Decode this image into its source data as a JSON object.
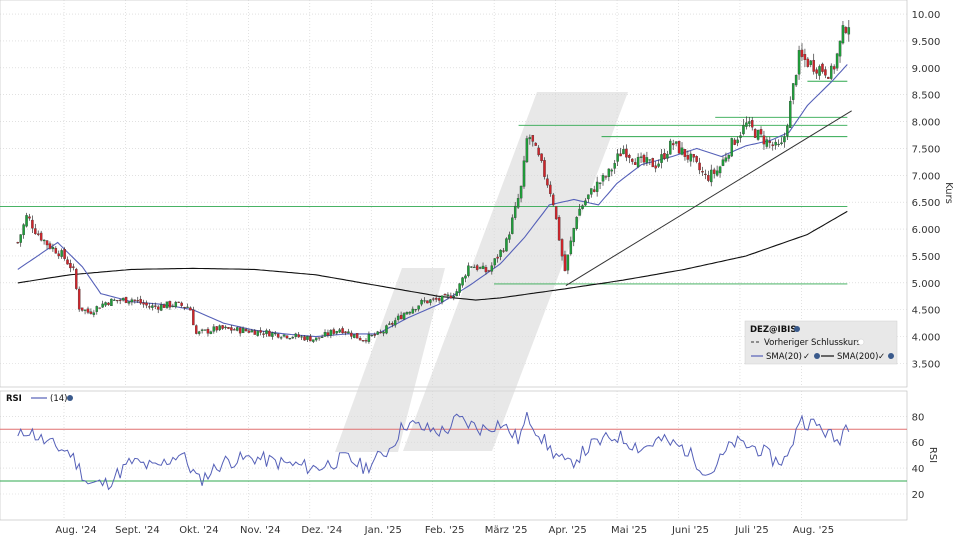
{
  "chart_data": {
    "type": "candlestick",
    "symbol": "DEZ@IBIS",
    "x_labels": [
      "Aug. '24",
      "Sept. '24",
      "Okt. '24",
      "Nov. '24",
      "Dez. '24",
      "Jan. '25",
      "Feb. '25",
      "März '25",
      "Apr. '25",
      "Mai '25",
      "Juni '25",
      "Juli '25",
      "Aug. '25"
    ],
    "price_axis": {
      "label": "Kurs",
      "ticks": [
        "10.00",
        "9.500",
        "9.000",
        "8.500",
        "8.000",
        "7.500",
        "7.000",
        "6.500",
        "6.000",
        "5.500",
        "5.000",
        "4.500",
        "4.000",
        "3.500"
      ],
      "ylim": [
        3.1,
        10.15
      ]
    },
    "rsi_axis": {
      "label": "RSI",
      "ticks": [
        "80",
        "60",
        "40",
        "20"
      ],
      "ylim": [
        0,
        100
      ],
      "overbought": 70,
      "oversold": 30
    },
    "legend": {
      "title": "DEZ@IBIS",
      "prev_close": "Vorheriger Schlusskurs",
      "sma20": "SMA(20)",
      "sma200": "SMA(200)"
    },
    "rsi_legend": {
      "title": "RSI",
      "period": "(14)"
    },
    "horizontal_levels": [
      {
        "y": 6.42,
        "from": 0.0,
        "to": 12.65
      },
      {
        "y": 4.98,
        "from": 6.9,
        "to": 12.65
      },
      {
        "y": 7.93,
        "from": 7.3,
        "to": 12.65
      },
      {
        "y": 7.72,
        "from": 8.65,
        "to": 12.65
      },
      {
        "y": 8.08,
        "from": 10.5,
        "to": 12.65
      },
      {
        "y": 8.75,
        "from": 12.0,
        "to": 12.65
      }
    ],
    "trendline": {
      "x1": 8.07,
      "y1": 4.95,
      "x2": 12.72,
      "y2": 8.2
    },
    "ohlc_anchors": [
      {
        "m": -0.85,
        "c": 5.75
      },
      {
        "m": -0.7,
        "c": 6.25
      },
      {
        "m": -0.55,
        "c": 5.95
      },
      {
        "m": -0.35,
        "c": 5.7
      },
      {
        "m": -0.15,
        "c": 5.55
      },
      {
        "m": 0.05,
        "c": 5.25
      },
      {
        "m": 0.15,
        "c": 4.55
      },
      {
        "m": 0.3,
        "c": 4.45
      },
      {
        "m": 0.6,
        "c": 4.65
      },
      {
        "m": 1.0,
        "c": 4.7
      },
      {
        "m": 1.3,
        "c": 4.55
      },
      {
        "m": 1.7,
        "c": 4.6
      },
      {
        "m": 1.95,
        "c": 4.55
      },
      {
        "m": 2.05,
        "c": 4.05
      },
      {
        "m": 2.4,
        "c": 4.15
      },
      {
        "m": 3.0,
        "c": 4.1
      },
      {
        "m": 3.35,
        "c": 4.05
      },
      {
        "m": 3.7,
        "c": 4.0
      },
      {
        "m": 4.0,
        "c": 3.95
      },
      {
        "m": 4.4,
        "c": 4.15
      },
      {
        "m": 4.75,
        "c": 3.95
      },
      {
        "m": 5.05,
        "c": 4.05
      },
      {
        "m": 5.45,
        "c": 4.45
      },
      {
        "m": 5.75,
        "c": 4.65
      },
      {
        "m": 6.1,
        "c": 4.7
      },
      {
        "m": 6.3,
        "c": 4.85
      },
      {
        "m": 6.5,
        "c": 5.35
      },
      {
        "m": 6.8,
        "c": 5.2
      },
      {
        "m": 7.1,
        "c": 5.75
      },
      {
        "m": 7.35,
        "c": 6.8
      },
      {
        "m": 7.45,
        "c": 7.8
      },
      {
        "m": 7.65,
        "c": 7.25
      },
      {
        "m": 7.85,
        "c": 6.6
      },
      {
        "m": 7.95,
        "c": 5.9
      },
      {
        "m": 8.05,
        "c": 5.2
      },
      {
        "m": 8.25,
        "c": 6.3
      },
      {
        "m": 8.55,
        "c": 6.8
      },
      {
        "m": 8.75,
        "c": 7.0
      },
      {
        "m": 9.0,
        "c": 7.5
      },
      {
        "m": 9.25,
        "c": 7.25
      },
      {
        "m": 9.55,
        "c": 7.2
      },
      {
        "m": 9.8,
        "c": 7.6
      },
      {
        "m": 10.1,
        "c": 7.3
      },
      {
        "m": 10.35,
        "c": 6.95
      },
      {
        "m": 10.55,
        "c": 7.1
      },
      {
        "m": 10.75,
        "c": 7.55
      },
      {
        "m": 11.0,
        "c": 7.95
      },
      {
        "m": 11.25,
        "c": 7.7
      },
      {
        "m": 11.5,
        "c": 7.5
      },
      {
        "m": 11.6,
        "c": 7.55
      },
      {
        "m": 11.75,
        "c": 8.5
      },
      {
        "m": 11.85,
        "c": 9.2
      },
      {
        "m": 12.1,
        "c": 9.05
      },
      {
        "m": 12.4,
        "c": 8.9
      },
      {
        "m": 12.5,
        "c": 9.3
      },
      {
        "m": 12.6,
        "c": 9.75
      },
      {
        "m": 12.68,
        "c": 9.85
      }
    ],
    "sma20_anchors": [
      {
        "m": -0.85,
        "v": 5.25
      },
      {
        "m": -0.4,
        "v": 5.6
      },
      {
        "m": -0.2,
        "v": 5.75
      },
      {
        "m": 0.2,
        "v": 5.3
      },
      {
        "m": 0.5,
        "v": 4.8
      },
      {
        "m": 1.0,
        "v": 4.65
      },
      {
        "m": 1.5,
        "v": 4.6
      },
      {
        "m": 2.0,
        "v": 4.5
      },
      {
        "m": 2.5,
        "v": 4.25
      },
      {
        "m": 3.0,
        "v": 4.12
      },
      {
        "m": 3.5,
        "v": 4.05
      },
      {
        "m": 4.0,
        "v": 4.0
      },
      {
        "m": 4.5,
        "v": 4.05
      },
      {
        "m": 5.0,
        "v": 4.05
      },
      {
        "m": 5.5,
        "v": 4.35
      },
      {
        "m": 6.0,
        "v": 4.6
      },
      {
        "m": 6.5,
        "v": 4.95
      },
      {
        "m": 7.0,
        "v": 5.35
      },
      {
        "m": 7.4,
        "v": 5.85
      },
      {
        "m": 7.8,
        "v": 6.45
      },
      {
        "m": 8.2,
        "v": 6.55
      },
      {
        "m": 8.6,
        "v": 6.45
      },
      {
        "m": 8.9,
        "v": 6.85
      },
      {
        "m": 9.3,
        "v": 7.2
      },
      {
        "m": 9.8,
        "v": 7.35
      },
      {
        "m": 10.2,
        "v": 7.5
      },
      {
        "m": 10.6,
        "v": 7.35
      },
      {
        "m": 11.0,
        "v": 7.55
      },
      {
        "m": 11.4,
        "v": 7.65
      },
      {
        "m": 11.7,
        "v": 7.8
      },
      {
        "m": 12.0,
        "v": 8.3
      },
      {
        "m": 12.4,
        "v": 8.75
      },
      {
        "m": 12.68,
        "v": 9.1
      }
    ],
    "sma200_anchors": [
      {
        "m": -0.85,
        "v": 5.0
      },
      {
        "m": 0.0,
        "v": 5.15
      },
      {
        "m": 1.0,
        "v": 5.25
      },
      {
        "m": 2.0,
        "v": 5.27
      },
      {
        "m": 3.0,
        "v": 5.25
      },
      {
        "m": 4.0,
        "v": 5.15
      },
      {
        "m": 5.0,
        "v": 4.95
      },
      {
        "m": 6.0,
        "v": 4.75
      },
      {
        "m": 6.6,
        "v": 4.68
      },
      {
        "m": 7.0,
        "v": 4.72
      },
      {
        "m": 8.0,
        "v": 4.88
      },
      {
        "m": 9.0,
        "v": 5.05
      },
      {
        "m": 10.0,
        "v": 5.25
      },
      {
        "m": 11.0,
        "v": 5.5
      },
      {
        "m": 12.0,
        "v": 5.9
      },
      {
        "m": 12.68,
        "v": 6.35
      }
    ],
    "rsi_anchors": [
      {
        "m": -0.85,
        "v": 63
      },
      {
        "m": -0.7,
        "v": 70
      },
      {
        "m": -0.4,
        "v": 60
      },
      {
        "m": 0.0,
        "v": 52
      },
      {
        "m": 0.15,
        "v": 40
      },
      {
        "m": 0.3,
        "v": 28
      },
      {
        "m": 0.6,
        "v": 28
      },
      {
        "m": 1.0,
        "v": 45
      },
      {
        "m": 1.4,
        "v": 40
      },
      {
        "m": 1.8,
        "v": 52
      },
      {
        "m": 2.1,
        "v": 30
      },
      {
        "m": 2.5,
        "v": 45
      },
      {
        "m": 3.0,
        "v": 48
      },
      {
        "m": 3.3,
        "v": 45
      },
      {
        "m": 3.7,
        "v": 42
      },
      {
        "m": 4.0,
        "v": 40
      },
      {
        "m": 4.5,
        "v": 48
      },
      {
        "m": 4.8,
        "v": 40
      },
      {
        "m": 5.2,
        "v": 55
      },
      {
        "m": 5.45,
        "v": 75
      },
      {
        "m": 5.8,
        "v": 70
      },
      {
        "m": 6.1,
        "v": 68
      },
      {
        "m": 6.3,
        "v": 78
      },
      {
        "m": 6.7,
        "v": 70
      },
      {
        "m": 7.0,
        "v": 75
      },
      {
        "m": 7.3,
        "v": 62
      },
      {
        "m": 7.45,
        "v": 80
      },
      {
        "m": 7.8,
        "v": 55
      },
      {
        "m": 8.1,
        "v": 42
      },
      {
        "m": 8.5,
        "v": 58
      },
      {
        "m": 8.9,
        "v": 65
      },
      {
        "m": 9.3,
        "v": 55
      },
      {
        "m": 9.6,
        "v": 62
      },
      {
        "m": 10.0,
        "v": 55
      },
      {
        "m": 10.4,
        "v": 35
      },
      {
        "m": 10.8,
        "v": 60
      },
      {
        "m": 11.2,
        "v": 55
      },
      {
        "m": 11.5,
        "v": 45
      },
      {
        "m": 11.7,
        "v": 48
      },
      {
        "m": 11.85,
        "v": 78
      },
      {
        "m": 12.2,
        "v": 72
      },
      {
        "m": 12.5,
        "v": 60
      },
      {
        "m": 12.6,
        "v": 72
      },
      {
        "m": 12.68,
        "v": 74
      }
    ],
    "grid": true,
    "legend_position": "bottom-right"
  }
}
